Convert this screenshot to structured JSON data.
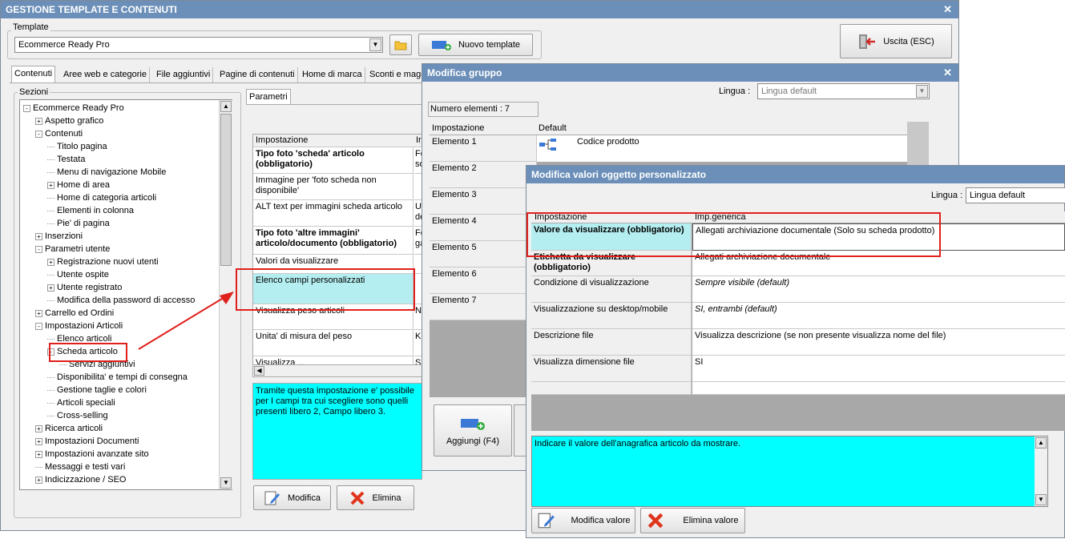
{
  "main": {
    "title": "GESTIONE TEMPLATE E CONTENUTI",
    "template_label": "Template",
    "template_value": "Ecommerce Ready Pro",
    "new_template": "Nuovo template",
    "exit": "Uscita (ESC)",
    "tabs": [
      "Contenuti",
      "Aree web e categorie",
      "File aggiuntivi",
      "Pagine di contenuti",
      "Home di marca",
      "Sconti e magg"
    ],
    "sections_label": "Sezioni",
    "params_tab": "Parametri",
    "tree": [
      {
        "label": "Ecommerce Ready Pro",
        "level": 0,
        "exp": "-"
      },
      {
        "label": "Aspetto grafico",
        "level": 1,
        "exp": "+"
      },
      {
        "label": "Contenuti",
        "level": 1,
        "exp": "-"
      },
      {
        "label": "Titolo pagina",
        "level": 2,
        "exp": ""
      },
      {
        "label": "Testata",
        "level": 2,
        "exp": ""
      },
      {
        "label": "Menu di navigazione Mobile",
        "level": 2,
        "exp": ""
      },
      {
        "label": "Home di area",
        "level": 2,
        "exp": "+"
      },
      {
        "label": "Home di categoria articoli",
        "level": 2,
        "exp": ""
      },
      {
        "label": "Elementi in colonna",
        "level": 2,
        "exp": ""
      },
      {
        "label": "Pie' di pagina",
        "level": 2,
        "exp": ""
      },
      {
        "label": "Inserzioni",
        "level": 1,
        "exp": "+"
      },
      {
        "label": "Parametri utente",
        "level": 1,
        "exp": "-"
      },
      {
        "label": "Registrazione nuovi utenti",
        "level": 2,
        "exp": "+"
      },
      {
        "label": "Utente ospite",
        "level": 2,
        "exp": ""
      },
      {
        "label": "Utente registrato",
        "level": 2,
        "exp": "+"
      },
      {
        "label": "Modifica della password di accesso",
        "level": 2,
        "exp": ""
      },
      {
        "label": "Carrello ed Ordini",
        "level": 1,
        "exp": "+"
      },
      {
        "label": "Impostazioni Articoli",
        "level": 1,
        "exp": "-"
      },
      {
        "label": "Elenco articoli",
        "level": 2,
        "exp": ""
      },
      {
        "label": "Scheda articolo",
        "level": 2,
        "exp": "-"
      },
      {
        "label": "Servizi aggiuntivi",
        "level": 3,
        "exp": ""
      },
      {
        "label": "Disponibilita' e tempi di consegna",
        "level": 2,
        "exp": ""
      },
      {
        "label": "Gestione taglie e colori",
        "level": 2,
        "exp": ""
      },
      {
        "label": "Articoli speciali",
        "level": 2,
        "exp": ""
      },
      {
        "label": "Cross-selling",
        "level": 2,
        "exp": ""
      },
      {
        "label": "Ricerca articoli",
        "level": 1,
        "exp": "+"
      },
      {
        "label": "Impostazioni Documenti",
        "level": 1,
        "exp": "+"
      },
      {
        "label": "Impostazioni avanzate sito",
        "level": 1,
        "exp": "+"
      },
      {
        "label": "Messaggi e testi vari",
        "level": 1,
        "exp": ""
      },
      {
        "label": "Indicizzazione / SEO",
        "level": 1,
        "exp": "+"
      }
    ],
    "grid_header": [
      "Impostazione",
      "Ir"
    ],
    "grid_rows": [
      {
        "label": "Tipo foto 'scheda' articolo (obbligatorio)",
        "value": "Fo so",
        "bold": true
      },
      {
        "label": "Immagine per 'foto scheda non disponibile'",
        "value": "",
        "bold": false
      },
      {
        "label": "ALT text per immagini scheda articolo",
        "value": "Ul de",
        "bold": false
      },
      {
        "label": "Tipo foto 'altre immagini' articolo/documento (obbligatorio)",
        "value": "Fo ga",
        "bold": true
      },
      {
        "label": "Valori da visualizzare",
        "value": "",
        "bold": false
      },
      {
        "label": "Elenco campi personalizzati",
        "value": "",
        "bold": false,
        "selected": true
      },
      {
        "label": "Visualizza peso articoli",
        "value": "N",
        "bold": false
      },
      {
        "label": "Unita' di misura del peso",
        "value": "Ki",
        "bold": false
      },
      {
        "label": "Visualizza ...",
        "value": "Si",
        "bold": false
      }
    ],
    "description": "Tramite questa impostazione e' possibile per I campi tra cui scegliere sono quelli presenti libero 2, Campo libero 3.",
    "edit_btn": "Modifica",
    "delete_btn": "Elimina"
  },
  "group": {
    "title": "Modifica gruppo",
    "lang_label": "Lingua :",
    "lang_value": "Lingua default",
    "count": "Numero elementi : 7",
    "header": [
      "Impostazione",
      "Default"
    ],
    "rows": [
      "Elemento 1",
      "Elemento 2",
      "Elemento 3",
      "Elemento 4",
      "Elemento 5",
      "Elemento 6",
      "Elemento 7"
    ],
    "first_value": "Codice prodotto",
    "add_btn": "Aggiungi (F4)"
  },
  "custom": {
    "title": "Modifica valori oggetto personalizzato",
    "lang_label": "Lingua :",
    "lang_value": "Lingua default",
    "header": [
      "Impostazione",
      "Imp.generica"
    ],
    "rows": [
      {
        "label": "Valore da visualizzare (obbligatorio)",
        "value": "Allegati archiviazione documentale (Solo su scheda prodotto)",
        "bold": true,
        "italic": false
      },
      {
        "label": "Etichetta da visualizzare (obbligatorio)",
        "value": "Allegati archiviazione documentale",
        "bold": true,
        "italic": false
      },
      {
        "label": "Condizione di visualizzazione",
        "value": "Sempre visibile (default)",
        "bold": false,
        "italic": true
      },
      {
        "label": "Visualizzazione su desktop/mobile",
        "value": "SI, entrambi (default)",
        "bold": false,
        "italic": true
      },
      {
        "label": "Descrizione file",
        "value": "Visualizza descrizione (se non presente visualizza nome del file)",
        "bold": false,
        "italic": false
      },
      {
        "label": "Visualizza dimensione file",
        "value": "SI",
        "bold": false,
        "italic": false
      }
    ],
    "description": "Indicare il valore dell'anagrafica articolo da mostrare.",
    "edit_btn": "Modifica valore",
    "delete_btn": "Elimina valore"
  },
  "colors": {
    "title_bar": "#6b8fb8",
    "highlight": "#b4eef0",
    "desc_bg": "#00ffff",
    "annotation": "#e0201c"
  }
}
